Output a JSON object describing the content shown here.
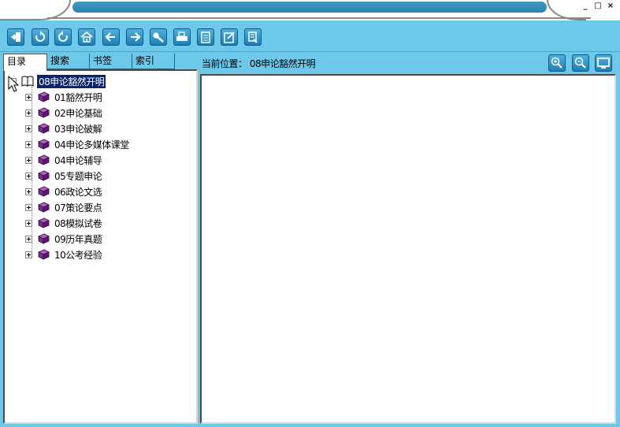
{
  "window": {
    "minimize_label": "_",
    "maximize_label": "□",
    "close_label": "×"
  },
  "toolbar": {
    "buttons": [
      {
        "name": "exit-button",
        "icon": "exit-icon"
      },
      {
        "name": "refresh-button",
        "icon": "refresh-icon"
      },
      {
        "name": "back-rotate-button",
        "icon": "rotate-left-icon"
      },
      {
        "name": "home-button",
        "icon": "home-icon"
      },
      {
        "name": "previous-button",
        "icon": "arrow-left-icon"
      },
      {
        "name": "next-button",
        "icon": "arrow-right-icon"
      },
      {
        "name": "search-button",
        "icon": "key-icon"
      },
      {
        "name": "print-button",
        "icon": "print-icon"
      },
      {
        "name": "notes-button",
        "icon": "notes-icon"
      },
      {
        "name": "bookmark-add-button",
        "icon": "bookmark-add-icon"
      },
      {
        "name": "bookmark-list-button",
        "icon": "bookmark-list-icon"
      }
    ]
  },
  "tabs": [
    {
      "label": "目录",
      "active": true
    },
    {
      "label": "搜索",
      "active": false
    },
    {
      "label": "书签",
      "active": false
    },
    {
      "label": "索引",
      "active": false
    }
  ],
  "tree": {
    "root": {
      "label": "08申论豁然开明",
      "icon": "open-book-icon"
    },
    "items": [
      {
        "label": "01豁然开明"
      },
      {
        "label": "02申论基础"
      },
      {
        "label": "03申论破解"
      },
      {
        "label": "04申论多媒体课堂"
      },
      {
        "label": "04申论辅导"
      },
      {
        "label": "05专题申论"
      },
      {
        "label": "06政论文选"
      },
      {
        "label": "07策论要点"
      },
      {
        "label": "08模拟试卷"
      },
      {
        "label": "09历年真题"
      },
      {
        "label": "10公考经验"
      }
    ]
  },
  "location": {
    "text": "当前位置： 08申论豁然开明"
  },
  "zoom": {
    "buttons": [
      {
        "name": "zoom-in-button",
        "icon": "zoom-in-icon"
      },
      {
        "name": "zoom-out-button",
        "icon": "zoom-out-icon"
      },
      {
        "name": "fullscreen-button",
        "icon": "monitor-icon"
      }
    ]
  },
  "colors": {
    "background": "#6ec8ea",
    "button": "#1e7fb4",
    "book": "#7a2a8a",
    "selection": "#0a246a"
  }
}
